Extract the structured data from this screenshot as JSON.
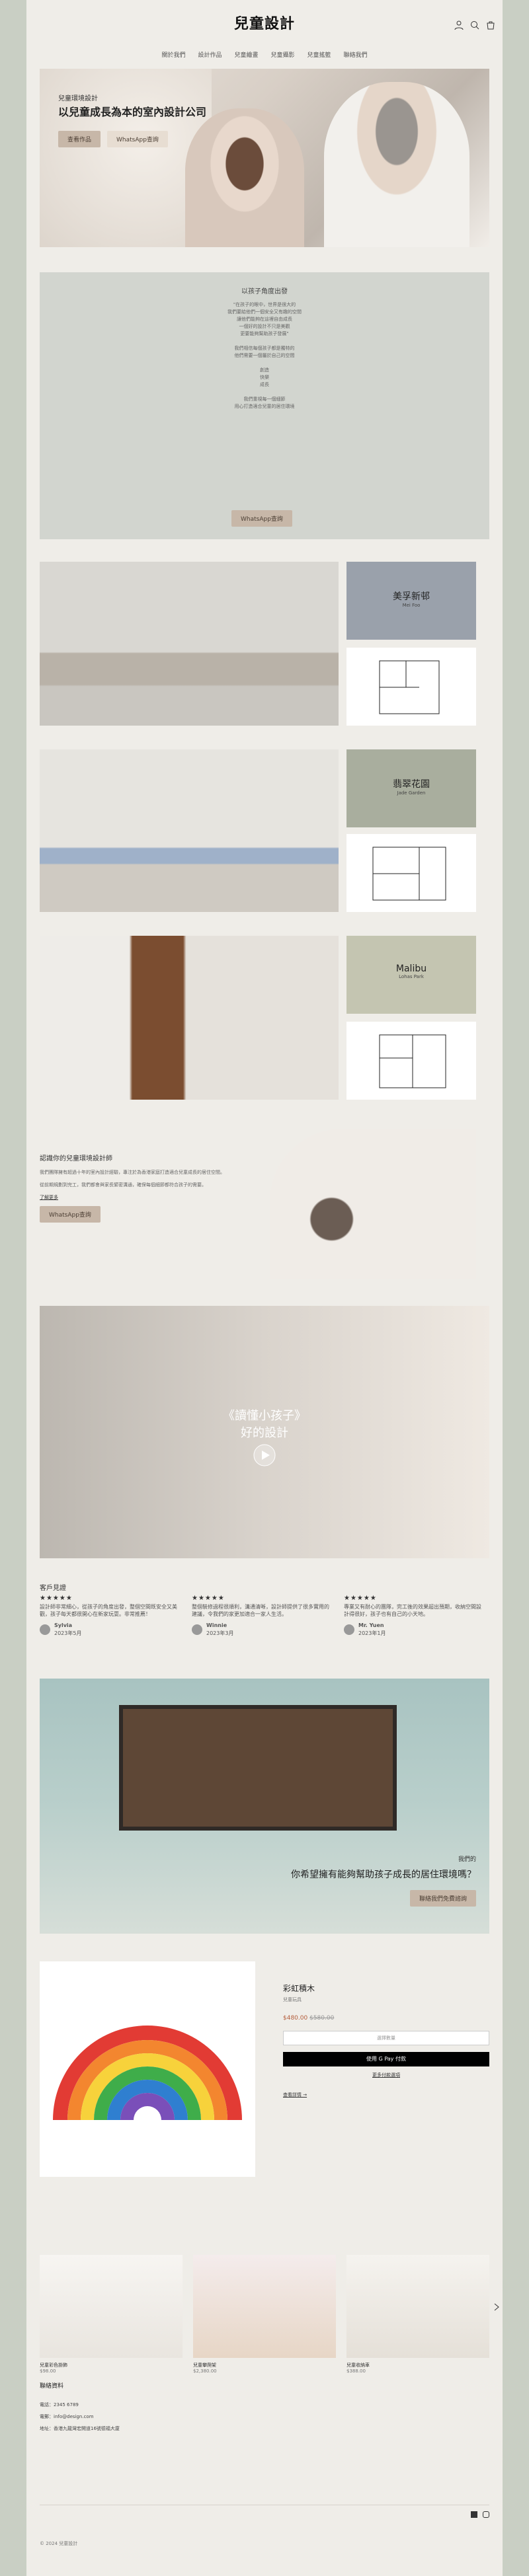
{
  "brand": {
    "logo": "兒童設計"
  },
  "nav": [
    "關於我們",
    "設計作品",
    "兒童繪畫",
    "兒童攝影",
    "兒童搖籃",
    "聯絡我們"
  ],
  "hero": {
    "small": "兒童環境設計",
    "title": "以兒童成長為本的室內設計公司",
    "btn1": "查看作品",
    "btn2": "WhatsApp查詢"
  },
  "philosophy": {
    "heading": "以孩子角度出發",
    "lines": [
      "\"在孩子的眼中，世界是很大的",
      "我們要給他們一個安全又有趣的空間",
      "讓他們能夠在這裡自由成長",
      "一個好的設計不只是美觀",
      "更要能夠幫助孩子發展\"",
      "",
      "我們相信每個孩子都是獨特的",
      "他們需要一個屬於自己的空間",
      "",
      "創造",
      "快樂",
      "成長",
      "",
      "我們重視每一個細節",
      "用心打造適合兒童的居住環境"
    ],
    "btn": "WhatsApp查詢"
  },
  "projects": [
    {
      "name": "美孚新邨",
      "sub": "Mei Foo"
    },
    {
      "name": "翡翠花園",
      "sub": "Jade Garden"
    },
    {
      "name": "Malibu",
      "sub": "Lohas Park"
    }
  ],
  "design": {
    "title": "認識你的兒童環境設計師",
    "text1": "我們團隊擁有超過十年的室內設計經驗，專注於為香港家庭打造適合兒童成長的居住空間。",
    "text2": "從前期規劃到完工，我們都會與家長緊密溝通，確保每個細節都符合孩子的需要。",
    "link": "了解更多",
    "btn": "WhatsApp查詢"
  },
  "video": {
    "line1": "《讀懂小孩子》",
    "line2": "好的設計"
  },
  "reviews": {
    "heading": "客戶見證",
    "items": [
      {
        "text": "設計師非常細心，從孩子的角度出發，整個空間既安全又美觀，孩子每天都很開心在新家玩耍。非常推薦！",
        "name": "Sylvia",
        "date": "2023年5月"
      },
      {
        "text": "整個裝修過程很順利，溝通清晰，設計師提供了很多實用的建議，令我們的家更加適合一家人生活。",
        "name": "Winnie",
        "date": "2023年3月"
      },
      {
        "text": "專業又有耐心的團隊，完工後的效果超出預期，收納空間設計得很好，孩子也有自己的小天地。",
        "name": "Mr. Yuen",
        "date": "2023年1月"
      }
    ]
  },
  "banner": {
    "small": "我們的",
    "q": "你希望擁有能夠幫助孩子成長的居住環境嗎？",
    "btn": "聯絡我們免費諮詢"
  },
  "product": {
    "title": "彩虹積木",
    "sub": "兒童玩具",
    "price": "$480.00",
    "old": "$580.00",
    "qty": "選擇數量",
    "pay": "使用 G Pay 付款",
    "more": "更多付款選項",
    "detail": "查看詳情 →"
  },
  "related": [
    {
      "name": "兒童彩色掛飾",
      "price": "$98.00"
    },
    {
      "name": "兒童攀爬架",
      "price": "$2,380.00"
    },
    {
      "name": "兒童收納車",
      "price": "$388.00"
    }
  ],
  "footer": {
    "heading": "聯絡資料",
    "phone": "電話：2345 6789",
    "email": "電郵：info@design.com",
    "addr": "地址：香港九龍灣宏開道16號德福大廈",
    "copy": "© 2024 兒童設計"
  },
  "colors": {
    "bg": "#c9cfc4",
    "page": "#efede8",
    "panel": "#d2d5cf",
    "tan": "#c7b7a8"
  },
  "chart_data": null
}
